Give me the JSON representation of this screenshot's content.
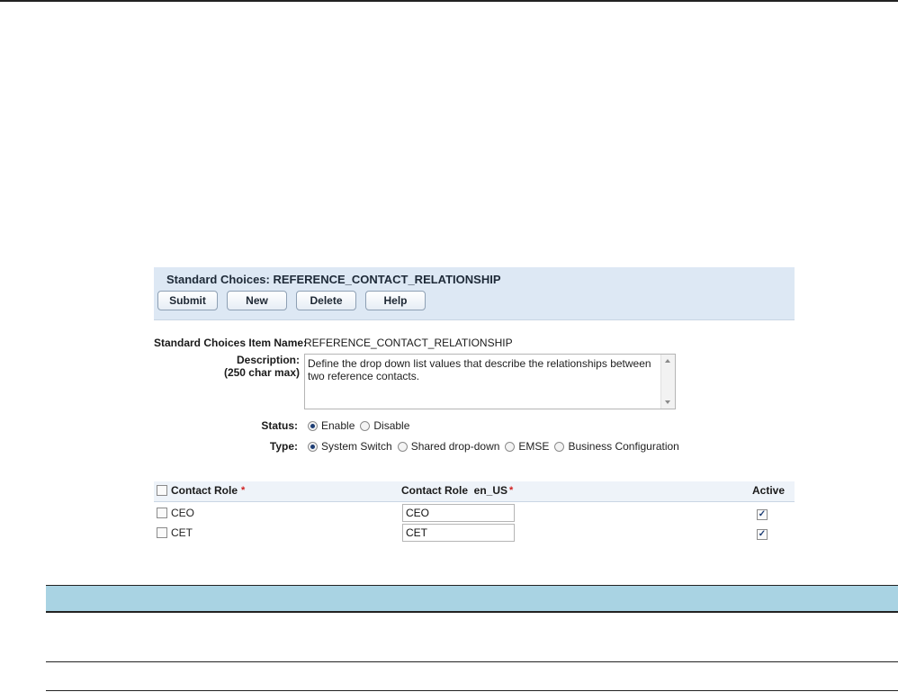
{
  "panel": {
    "title": "Standard Choices: REFERENCE_CONTACT_RELATIONSHIP",
    "buttons": [
      "Submit",
      "New",
      "Delete",
      "Help"
    ]
  },
  "form": {
    "item_name_label": "Standard Choices Item Name:",
    "item_name_value": "REFERENCE_CONTACT_RELATIONSHIP",
    "description_label": "Description:",
    "description_hint": "(250 char max)",
    "description_value": "Define the drop down list values that describe the relationships between two reference contacts.",
    "status_label": "Status:",
    "status_options": [
      "Enable",
      "Disable"
    ],
    "status_selected": "Enable",
    "type_label": "Type:",
    "type_options": [
      "System Switch",
      "Shared drop-down",
      "EMSE",
      "Business Configuration"
    ],
    "type_selected": "System Switch"
  },
  "grid": {
    "columns": [
      "Contact Role",
      "Contact Role  en_US",
      "Active"
    ],
    "required_mark": "*",
    "rows": [
      {
        "role": "CEO",
        "role_en_us": "CEO",
        "active": true
      },
      {
        "role": "CET",
        "role_en_us": "CET",
        "active": true
      }
    ]
  },
  "colors": {
    "panel_bg": "#dde8f4",
    "table_header_bg": "#a9d3e3",
    "required": "#d01e1e"
  }
}
